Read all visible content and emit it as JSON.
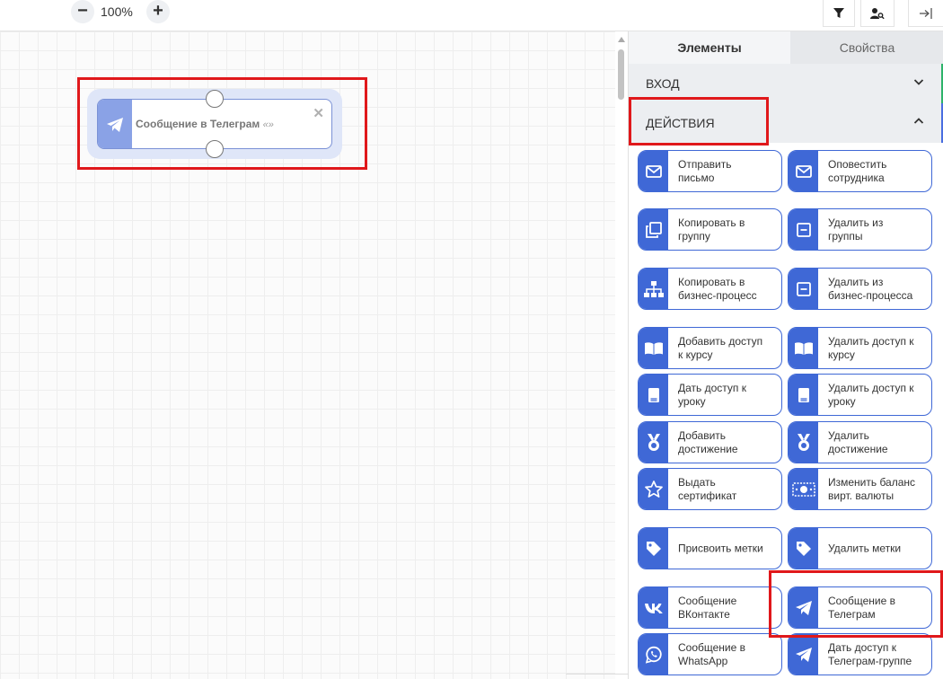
{
  "toolbar": {
    "zoom_out_label": "−",
    "zoom_level": "100%",
    "zoom_in_label": "+",
    "filter_icon": "filter-icon",
    "user_search_icon": "user-search-icon",
    "collapse_icon": "collapse-panel-icon"
  },
  "canvas": {
    "node": {
      "icon": "telegram-icon",
      "title": "Сообщение в Телеграм",
      "quote": "«»",
      "close": "✕"
    }
  },
  "panel": {
    "tabs": {
      "elements": "Элементы",
      "properties": "Свойства"
    },
    "sections": {
      "input": {
        "label": "ВХОД",
        "state": "collapsed"
      },
      "actions": {
        "label": "ДЕЙСТВИЯ",
        "state": "expanded"
      }
    },
    "cards": [
      {
        "label": "Отправить\nписьмо",
        "icon": "envelope-icon"
      },
      {
        "label": "Оповестить\nсотрудника",
        "icon": "envelope-icon"
      },
      {
        "label": "Копировать в\nгруппу",
        "icon": "copy-icon"
      },
      {
        "label": "Удалить из\nгруппы",
        "icon": "minus-square-icon"
      },
      {
        "label": "Копировать в\nбизнес-процесс",
        "icon": "sitemap-icon"
      },
      {
        "label": "Удалить из\nбизнес-процесса",
        "icon": "minus-square-icon"
      },
      {
        "label": "Добавить доступ\nк курсу",
        "icon": "book-open-icon"
      },
      {
        "label": "Удалить доступ к\nкурсу",
        "icon": "book-open-icon"
      },
      {
        "label": "Дать доступ к\nуроку",
        "icon": "book-icon"
      },
      {
        "label": "Удалить доступ к\nуроку",
        "icon": "book-icon"
      },
      {
        "label": "Добавить\nдостижение",
        "icon": "medal-icon"
      },
      {
        "label": "Удалить\nдостижение",
        "icon": "medal-icon"
      },
      {
        "label": "Выдать\nсертификат",
        "icon": "star-icon"
      },
      {
        "label": "Изменить баланс\nвирт. валюты",
        "icon": "money-bill-icon"
      },
      {
        "label": "Присвоить метки",
        "icon": "tag-icon"
      },
      {
        "label": "Удалить метки",
        "icon": "tag-icon"
      },
      {
        "label": "Сообщение\nВКонтакте",
        "icon": "vk-icon"
      },
      {
        "label": "Сообщение в\nТелеграм",
        "icon": "telegram-icon"
      },
      {
        "label": "Сообщение в\nWhatsApp",
        "icon": "whatsapp-icon"
      },
      {
        "label": "Дать доступ к\nТелеграм-группе",
        "icon": "telegram-icon"
      }
    ]
  },
  "colors": {
    "accent": "#3f68d6",
    "node_icon_bg": "#8aa2e6",
    "highlight": "#e0181b",
    "stripe_input": "#2db36a",
    "stripe_actions": "#4a6ee0"
  }
}
